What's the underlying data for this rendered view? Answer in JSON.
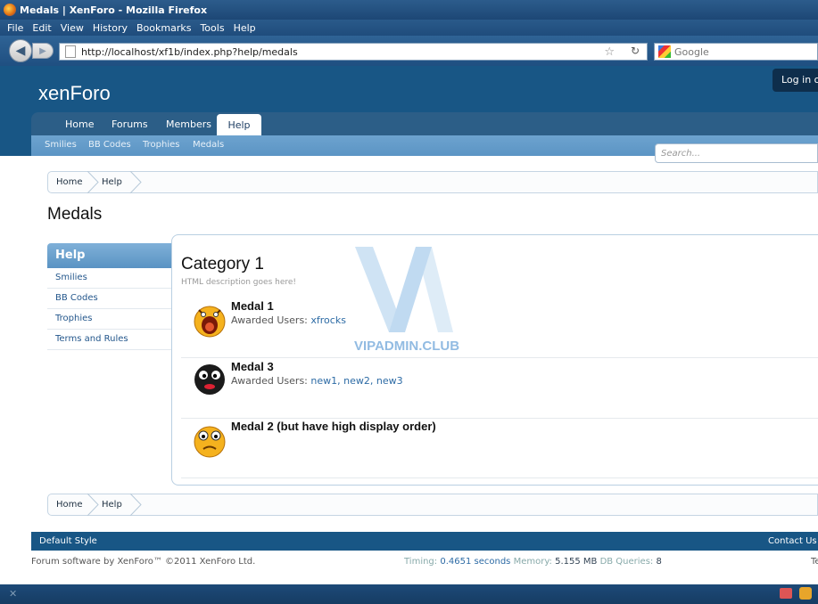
{
  "browser": {
    "title": "Medals | XenForo - Mozilla Firefox",
    "menu": [
      "File",
      "Edit",
      "View",
      "History",
      "Bookmarks",
      "Tools",
      "Help"
    ],
    "url": "http://localhost/xf1b/index.php?help/medals",
    "search_placeholder": "Google"
  },
  "site": {
    "logo": "xenForo",
    "login": "Log in or",
    "tabs": [
      "Home",
      "Forums",
      "Members",
      "Help"
    ],
    "active_tab": "Help",
    "subnav": [
      "Smilies",
      "BB Codes",
      "Trophies",
      "Medals"
    ],
    "search_placeholder": "Search..."
  },
  "breadcrumb": [
    "Home",
    "Help"
  ],
  "page_title": "Medals",
  "sidebar": {
    "heading": "Help",
    "items": [
      "Smilies",
      "BB Codes",
      "Trophies",
      "Terms and Rules"
    ]
  },
  "category": {
    "title": "Category 1",
    "description": "HTML description goes here!",
    "medals": [
      {
        "name": "Medal 1",
        "users_label": "Awarded Users:",
        "users": "xfrocks",
        "icon": "screaming-face-icon"
      },
      {
        "name": "Medal 3",
        "users_label": "Awarded Users:",
        "users": "new1, new2, new3",
        "icon": "black-bomb-face-icon"
      },
      {
        "name": "Medal 2 (but have high display order)",
        "users_label": "",
        "users": "",
        "icon": "confused-face-icon"
      }
    ]
  },
  "footer": {
    "style": "Default Style",
    "contact": "Contact Us",
    "copyright": "Forum software by XenForo™ ©2011 XenForo Ltd.",
    "timing_label": "Timing:",
    "timing_value": "0.4651 seconds",
    "memory_label": "Memory:",
    "memory_value": "5.155 MB",
    "db_label": "DB Queries:",
    "db_value": "8",
    "tail": "Te"
  },
  "watermark": "VIPADMIN.CLUB",
  "colors": {
    "header_blue": "#185685",
    "link": "#2d6ba5",
    "subnav": "#6da3cf"
  }
}
